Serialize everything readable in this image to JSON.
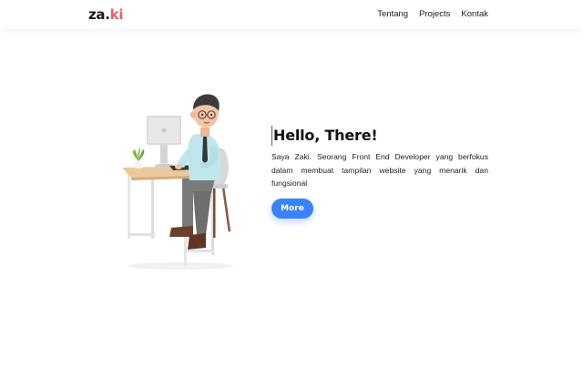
{
  "navbar": {
    "logo": {
      "prefix": "za.",
      "accent": "ki"
    },
    "links": [
      "Tentang",
      "Projects",
      "Kontak"
    ]
  },
  "hero": {
    "title": "Hello, There!",
    "description": "Saya Zaki. Seorang Front End Developer yang berfokus dalam membuat tampilan website yang menarik dan fungsional",
    "button_label": "More",
    "illustration": "developer-at-desk-illustration"
  },
  "colors": {
    "accent": "#ef5b6a",
    "button": "#3b82f6"
  }
}
